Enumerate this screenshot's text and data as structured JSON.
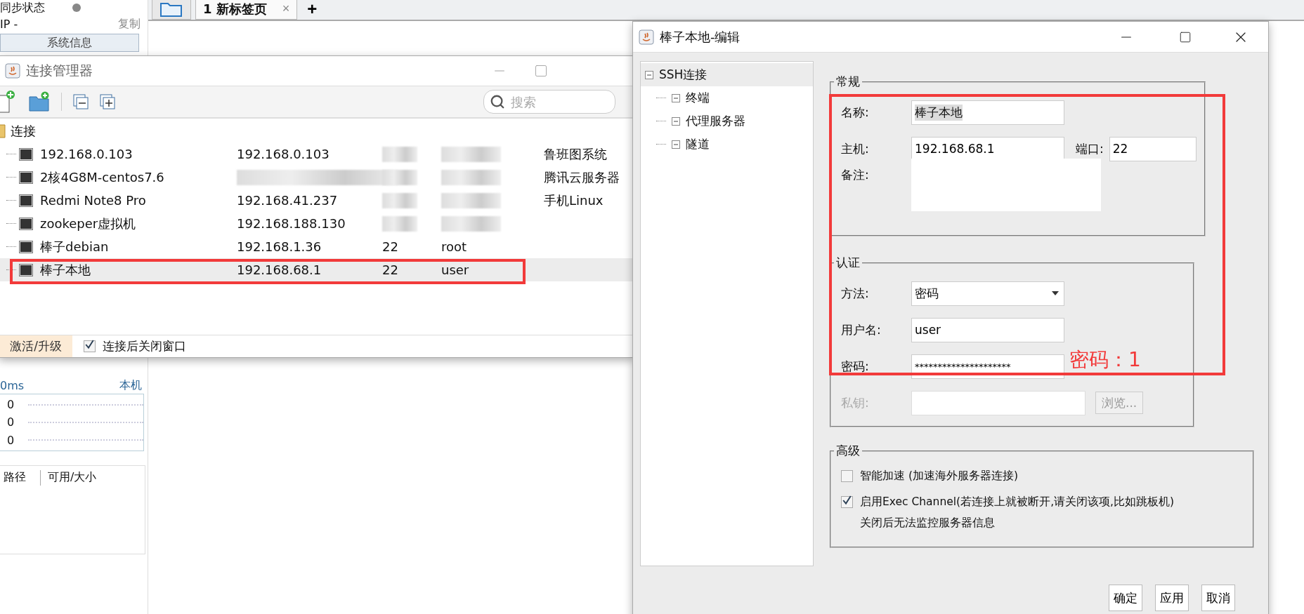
{
  "sidebar": {
    "sync_status": "同步状态",
    "ip_label": "IP  -",
    "copy": "复制",
    "sysinfo_button": "系统信息",
    "latency": "0ms",
    "host": "本机",
    "chart_labels": [
      "0",
      "0",
      "0"
    ],
    "disk_columns": [
      "路径",
      "可用/大小"
    ]
  },
  "tabs": [
    {
      "label": "1 新标签页",
      "selected": true
    }
  ],
  "tab_close": "×",
  "tab_add": "+",
  "connection_manager": {
    "title": "连接管理器",
    "search": {
      "placeholder": "搜索"
    },
    "root": {
      "label": "连接",
      "expanded": true,
      "children": [
        {
          "name": "192.168.0.103",
          "host": "192.168.0.103",
          "note": "鲁班图系统",
          "selected": false
        },
        {
          "name": "2核4G8M-centos7.6",
          "note": "腾讯云服务器",
          "selected": false
        },
        {
          "name": "Redmi Note8 Pro",
          "host": "192.168.41.237",
          "note": "手机Linux",
          "selected": false
        },
        {
          "name": "zookeper虚拟机",
          "host": "192.168.188.130",
          "selected": false
        },
        {
          "name": "棒子debian",
          "host": "192.168.1.36",
          "port": "22",
          "user": "root",
          "selected": false
        },
        {
          "name": "棒子本地",
          "host": "192.168.68.1",
          "port": "22",
          "user": "user",
          "selected": true
        }
      ]
    },
    "activate": "激活/升级",
    "close_after_connect": {
      "label": "连接后关闭窗口",
      "checked": true
    }
  },
  "edit_dialog": {
    "title": "棒子本地-编辑",
    "tree": {
      "label": "SSH连接",
      "selected": true,
      "expanded": true,
      "children": [
        {
          "label": "终端",
          "expanded": true
        },
        {
          "label": "代理服务器",
          "expanded": true
        },
        {
          "label": "隧道",
          "expanded": true
        }
      ]
    },
    "general": {
      "title": "常规",
      "name_label": "名称:",
      "name": "棒子本地",
      "name_selected": true,
      "host_label": "主机:",
      "host": "192.168.68.1",
      "port_label": "端口:",
      "port": "22",
      "note_label": "备注:"
    },
    "auth": {
      "title": "认证",
      "method_label": "方法:",
      "method": "密码",
      "user_label": "用户名:",
      "user": "user",
      "password_label": "密码:",
      "password": "*********************",
      "key_label": "私钥:",
      "key_disabled": true,
      "browse": "浏览..."
    },
    "advanced": {
      "title": "高级",
      "options": [
        {
          "label": "智能加速 (加速海外服务器连接)",
          "checked": false
        },
        {
          "label": "启用Exec Channel(若连接上就被断开,请关闭该项,比如跳板机)",
          "checked": true
        }
      ],
      "note": "关闭后无法监控服务器信息"
    },
    "buttons": [
      "确定",
      "应用",
      "取消"
    ]
  },
  "annotation": {
    "text": "密码：1"
  }
}
